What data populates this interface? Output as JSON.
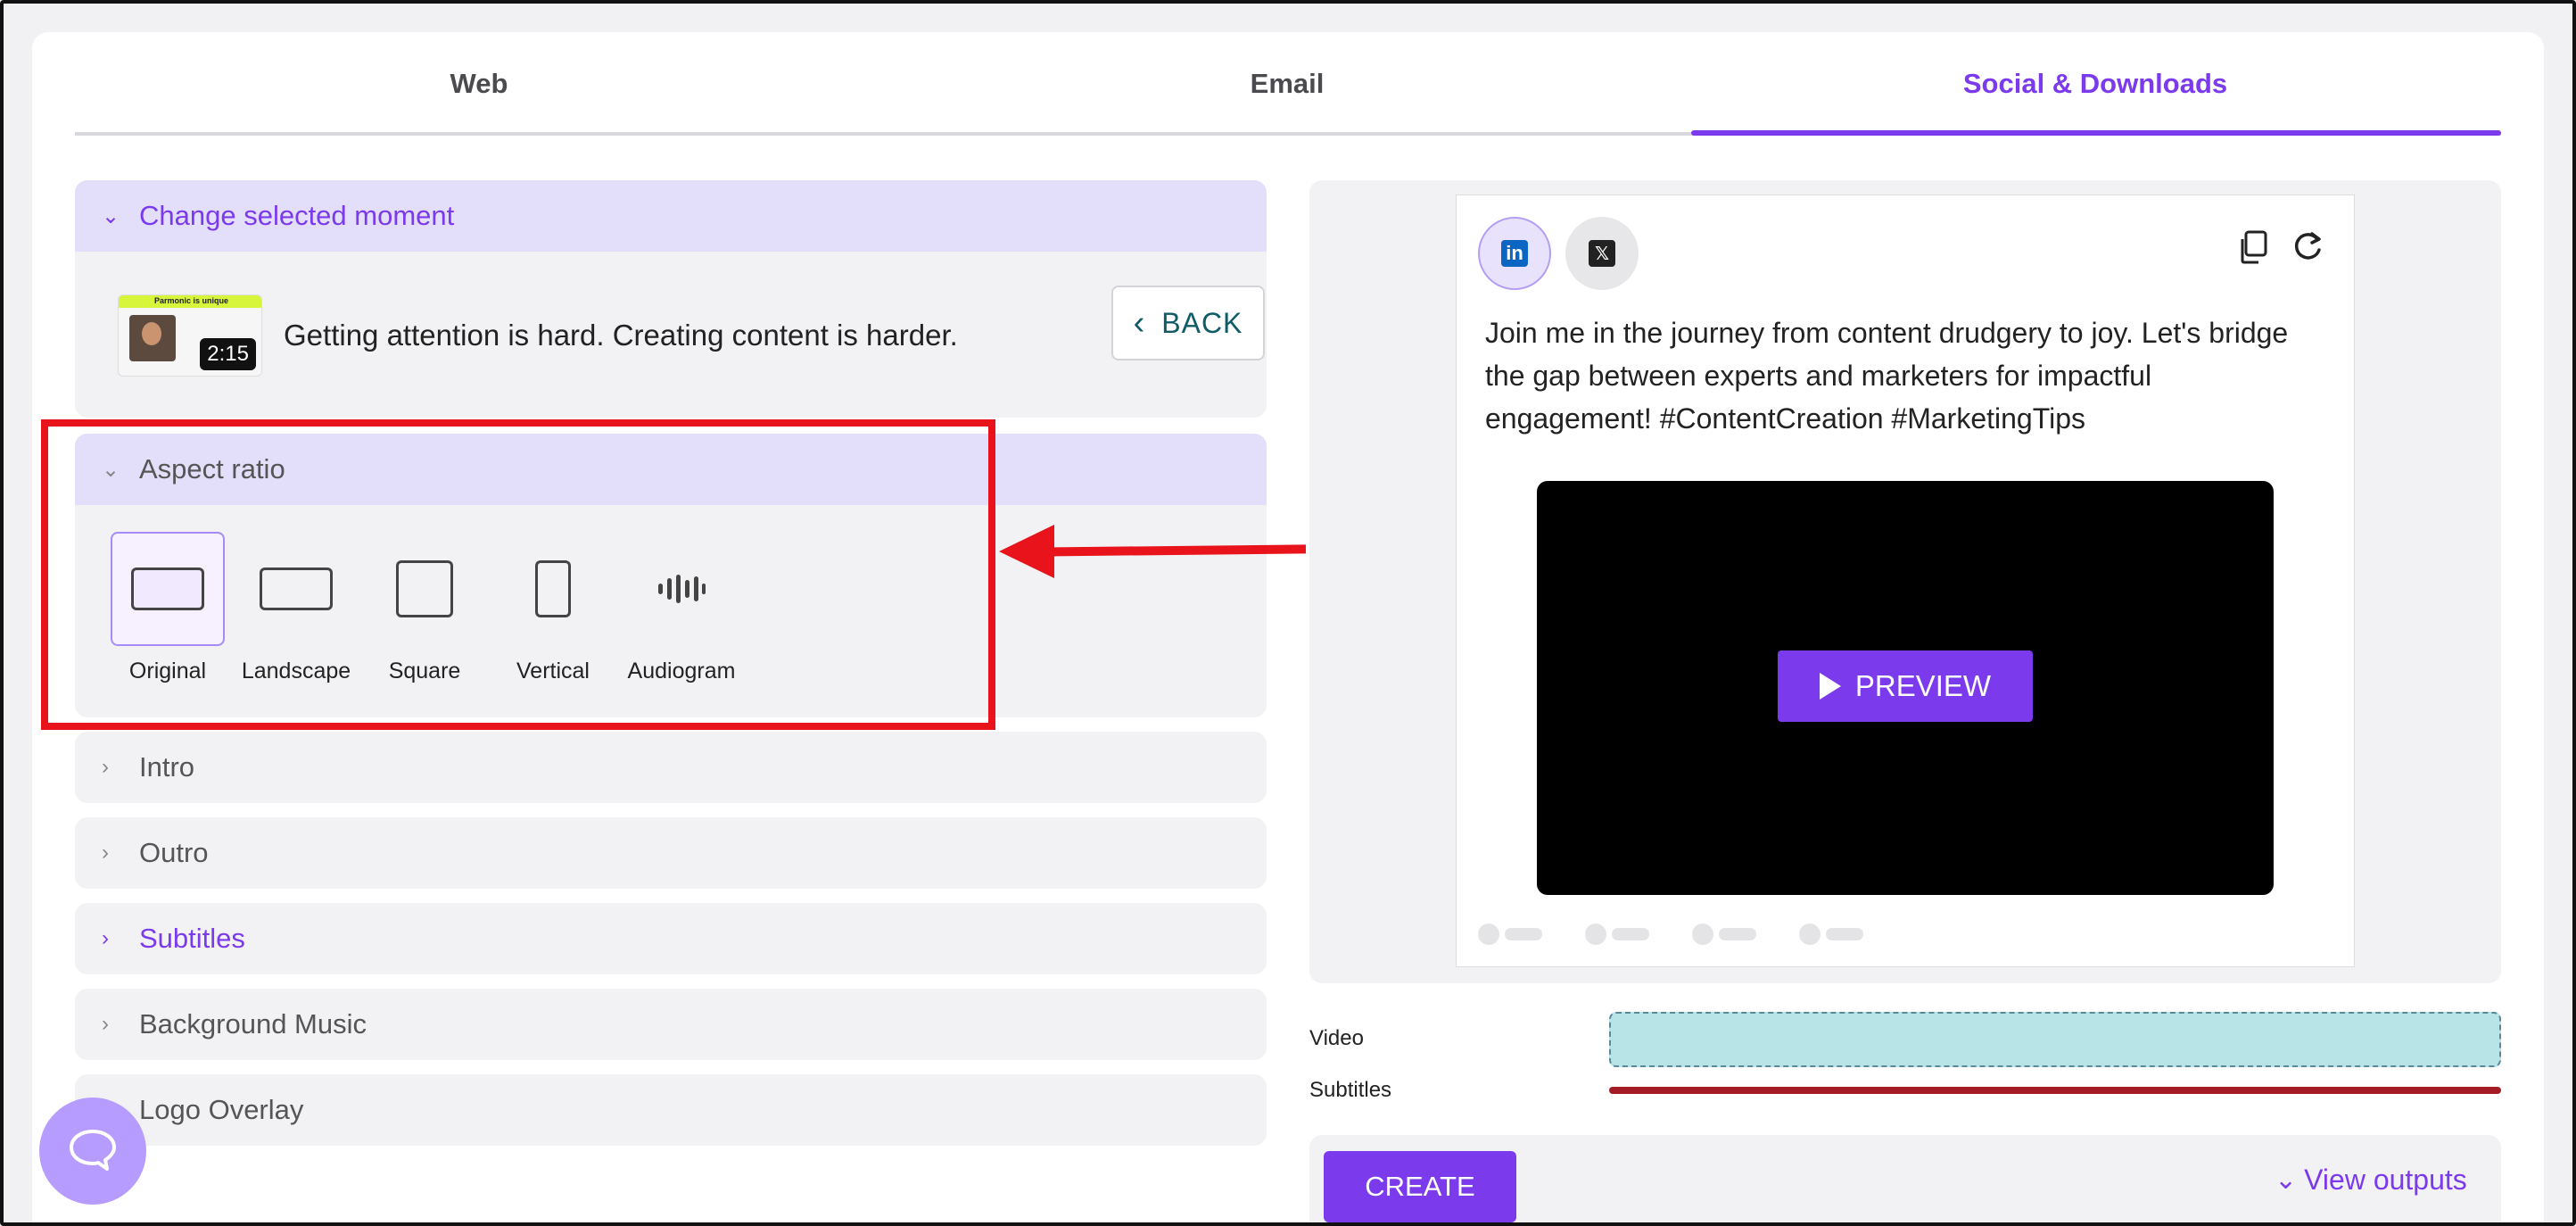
{
  "tabs": [
    {
      "label": "Web"
    },
    {
      "label": "Email"
    },
    {
      "label": "Social & Downloads"
    }
  ],
  "active_tab": "Social & Downloads",
  "moment": {
    "section_title": "Change selected moment",
    "thumbnail_title": "Parmonic is unique",
    "duration": "2:15",
    "text": "Getting attention is hard. Creating content is harder.",
    "back_label": "BACK"
  },
  "aspect_ratio": {
    "section_title": "Aspect ratio",
    "options": [
      {
        "label": "Original",
        "selected": true
      },
      {
        "label": "Landscape",
        "selected": false
      },
      {
        "label": "Square",
        "selected": false
      },
      {
        "label": "Vertical",
        "selected": false
      },
      {
        "label": "Audiogram",
        "selected": false
      }
    ]
  },
  "sections": [
    {
      "label": "Intro"
    },
    {
      "label": "Outro"
    },
    {
      "label": "Subtitles"
    },
    {
      "label": "Background Music"
    },
    {
      "label": "Logo Overlay"
    }
  ],
  "post": {
    "linkedin_icon": "linkedin-icon",
    "x_icon": "x-icon",
    "text": "Join me in the journey from content drudgery to joy. Let's bridge the gap between experts and marketers for impactful engagement! #ContentCreation #MarketingTips",
    "preview_label": "PREVIEW"
  },
  "tracks": {
    "video_label": "Video",
    "subtitles_label": "Subtitles"
  },
  "actions": {
    "create_label": "CREATE",
    "view_outputs_label": "View outputs"
  },
  "colors": {
    "accent": "#7c3aed",
    "highlight": "#e8131b",
    "video_track": "#b8e4e8",
    "subtitle_track": "#a51b25"
  }
}
